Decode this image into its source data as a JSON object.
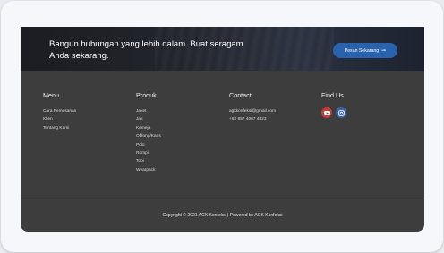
{
  "cta": {
    "text": "Bangun hubungan yang lebih dalam. Buat seragam Anda sekarang.",
    "button_label": "Pesan Sekarang",
    "button_color": "#2a63ad"
  },
  "footer": {
    "menu": {
      "title": "Menu",
      "items": [
        "Cara Pemesanan",
        "Klien",
        "Tentang Kami"
      ]
    },
    "produk": {
      "title": "Produk",
      "items": [
        "Jaket",
        "Jas",
        "Kemeja",
        "Oblong/Kaos",
        "Polo",
        "Rompi",
        "Topi",
        "Wearpack"
      ]
    },
    "contact": {
      "title": "Contact",
      "email": "agkkonfeksi@gmail.com",
      "phone": "+62 857 4067 4823"
    },
    "findus": {
      "title": "Find Us",
      "icons": [
        "youtube-icon",
        "instagram-icon"
      ],
      "youtube_color": "#c93b36",
      "instagram_color": "#3b67a8"
    }
  },
  "copyright": "Copyright © 2021 AGK Konfeksi | Powered by AGK Konfeksi",
  "colors": {
    "footer_bg": "#3d3d3d",
    "page_bg": "#e9ebf0"
  }
}
